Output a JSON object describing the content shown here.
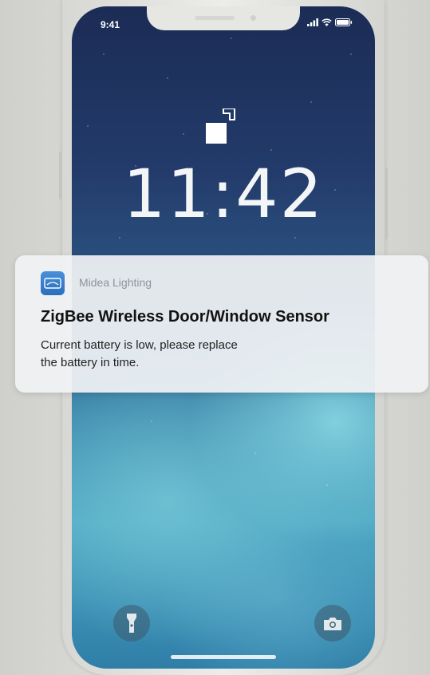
{
  "status_bar": {
    "time": "9:41",
    "icons": [
      "signal-icon",
      "wifi-icon",
      "battery-icon"
    ]
  },
  "lock_screen": {
    "icon": "lock-icon",
    "clock": "11:42",
    "bottom_left_icon": "flashlight-icon",
    "bottom_right_icon": "camera-icon"
  },
  "notification": {
    "app_icon": "midea-app-icon",
    "app_name": "Midea Lighting",
    "title": "ZigBee Wireless Door/Window Sensor",
    "body_line1": "Current battery is low, please replace",
    "body_line2": "the battery in time."
  },
  "colors": {
    "notification_bg": "#f0f2f4",
    "app_icon": "#2a6fc0",
    "wallpaper_top": "#1b2c55",
    "wallpaper_bottom": "#4ea8c4"
  }
}
